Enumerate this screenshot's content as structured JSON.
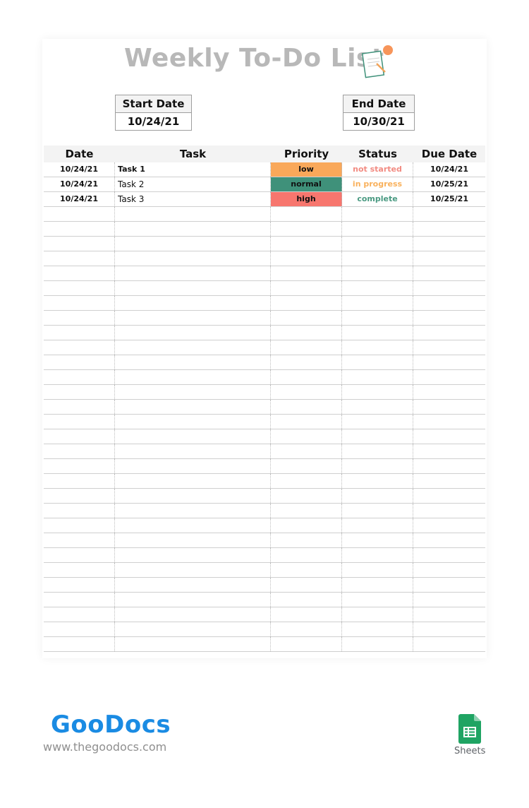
{
  "header": {
    "title": "Weekly To-Do List",
    "icon": "clipboard-pencil-icon"
  },
  "dates": {
    "start_label": "Start Date",
    "start_value": "10/24/21",
    "end_label": "End Date",
    "end_value": "10/30/21"
  },
  "table": {
    "columns": [
      "Date",
      "Task",
      "Priority",
      "Status",
      "Due Date"
    ],
    "rows": [
      {
        "date": "10/24/21",
        "task": "Task 1",
        "priority": "low",
        "status": "not started",
        "due": "10/24/21"
      },
      {
        "date": "10/24/21",
        "task": "Task 2",
        "priority": "normal",
        "status": "in progress",
        "due": "10/25/21"
      },
      {
        "date": "10/24/21",
        "task": "Task 3",
        "priority": "high",
        "status": "complete",
        "due": "10/25/21"
      }
    ],
    "empty_row_count": 30
  },
  "colors": {
    "priority_low": "#F9A85A",
    "priority_normal": "#3F917A",
    "priority_high": "#F7766E",
    "status_not_started": "#F28B82",
    "status_in_progress": "#F9B15C",
    "status_complete": "#4A9A82"
  },
  "footer": {
    "brand": "GooDocs",
    "url": "www.thegoodocs.com",
    "app_label": "Sheets",
    "app_icon": "google-sheets-icon"
  }
}
